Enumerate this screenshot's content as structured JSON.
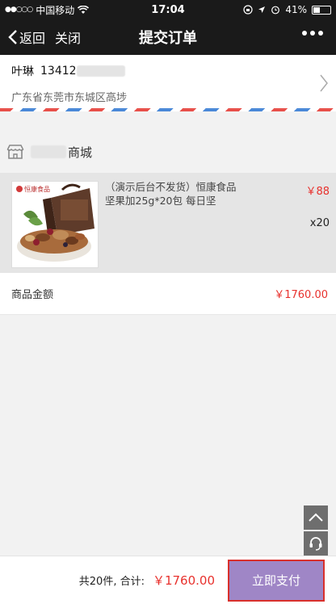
{
  "status_bar": {
    "carrier": "中国移动",
    "time": "17:04",
    "battery": "41%",
    "battery_level": 0.41
  },
  "nav": {
    "back_label": "返回",
    "close_label": "关闭",
    "title": "提交订单"
  },
  "address": {
    "name": "叶琳",
    "phone": "13412",
    "detail": "广东省东莞市东城区高埗"
  },
  "store": {
    "name_suffix": "商城"
  },
  "product": {
    "title": "（演示后台不发货）恒康食品 坚果加25g*20包 每日坚",
    "price": "￥88",
    "quantity": "x20",
    "image_brand": "恒康食品"
  },
  "summary": {
    "amount_label": "商品金额",
    "amount_value": "￥1760.00"
  },
  "footer": {
    "count_label": "共20件, 合计:",
    "total": "￥1760.00",
    "pay_button": "立即支付"
  },
  "colors": {
    "accent_red": "#e8312d",
    "pay_button": "#9f86c6",
    "nav_bg": "#1a1a1a"
  }
}
